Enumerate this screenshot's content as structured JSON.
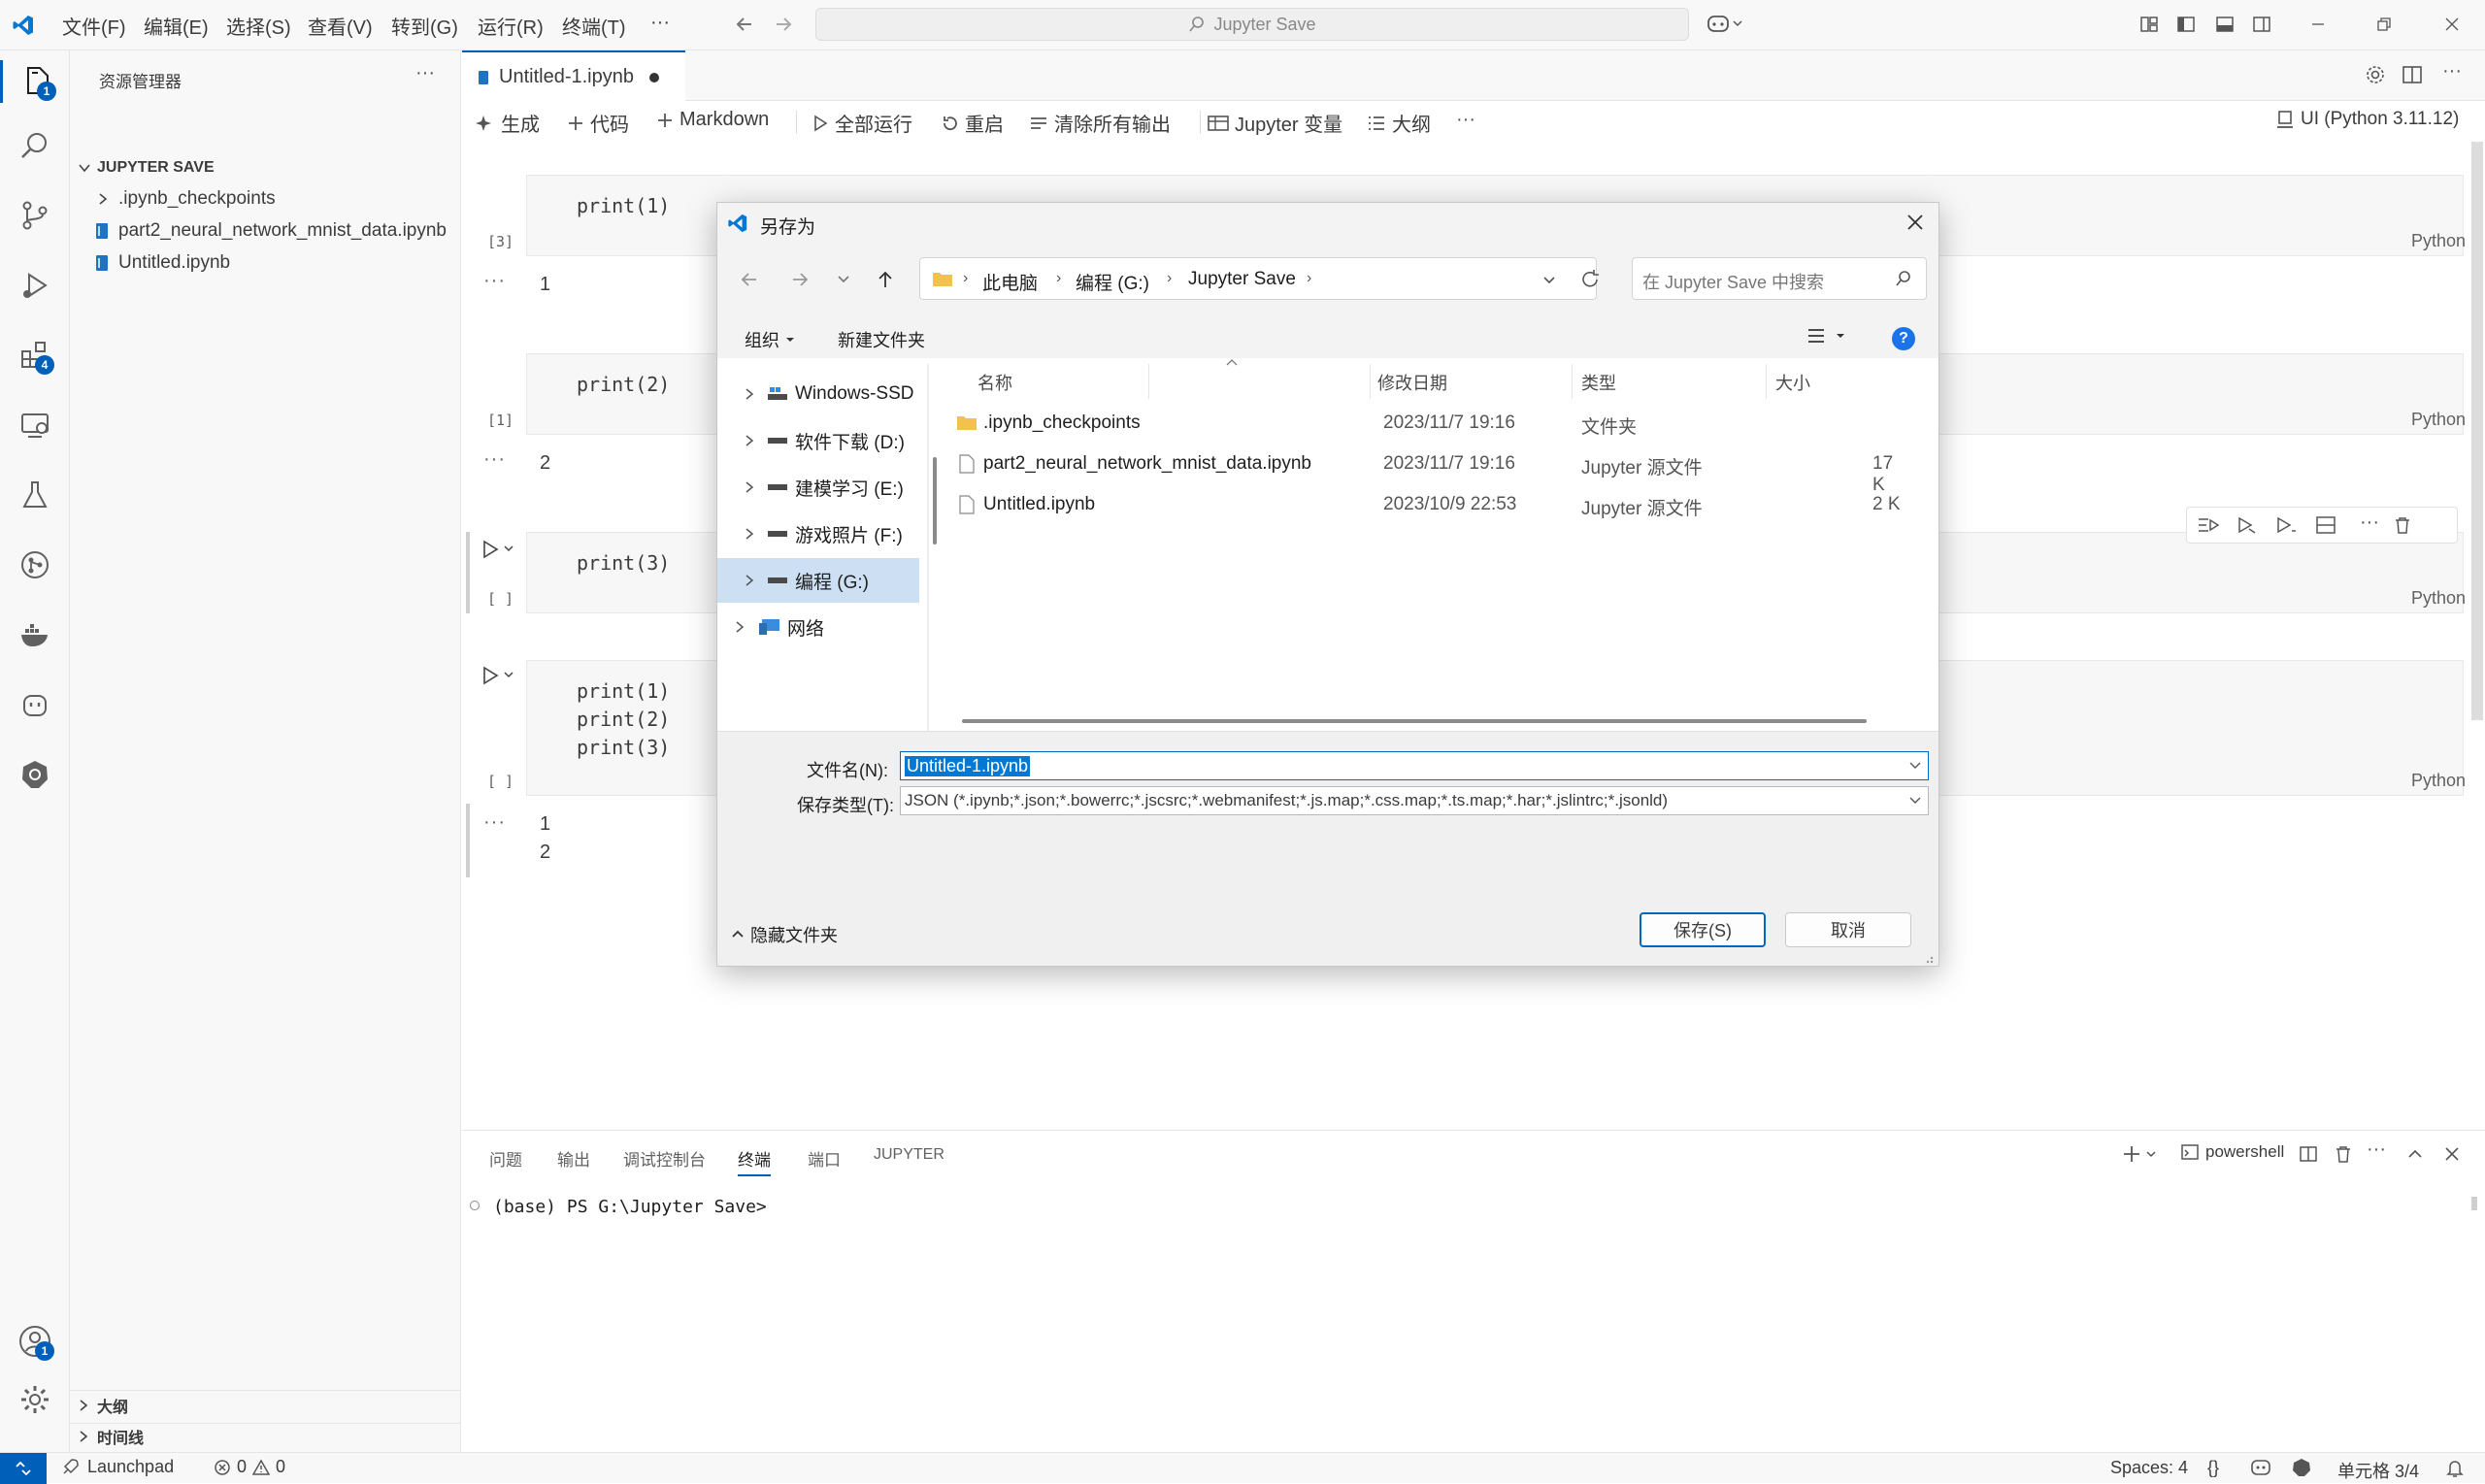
{
  "titlebar": {
    "menus": [
      "文件(F)",
      "编辑(E)",
      "选择(S)",
      "查看(V)",
      "转到(G)",
      "运行(R)",
      "终端(T)",
      "···"
    ],
    "search_text": "Jupyter Save"
  },
  "activity": {
    "explorer_badge": "1",
    "extensions_badge": "4",
    "accounts_badge": "1"
  },
  "sidebar": {
    "title": "资源管理器",
    "folder": "JUPYTER SAVE",
    "items": [
      ".ipynb_checkpoints",
      "part2_neural_network_mnist_data.ipynb",
      "Untitled.ipynb"
    ],
    "outline": "大纲",
    "timeline": "时间线"
  },
  "editor": {
    "tab_label": "Untitled-1.ipynb",
    "toolbar": {
      "generate": "生成",
      "code": "代码",
      "markdown": "Markdown",
      "run_all": "全部运行",
      "restart": "重启",
      "clear": "清除所有输出",
      "variables": "Jupyter 变量",
      "outline": "大纲",
      "more": "···",
      "kernel": "UI (Python 3.11.12)"
    },
    "cells": [
      {
        "count": "[3]",
        "code": [
          "print(1)"
        ],
        "lang": "Python",
        "output": [
          "1"
        ]
      },
      {
        "count": "[1]",
        "code": [
          "print(2)"
        ],
        "lang": "Python",
        "output": [
          "2"
        ]
      },
      {
        "count": "[ ]",
        "code": [
          "print(3)"
        ],
        "lang": "Python",
        "output": []
      },
      {
        "count": "[ ]",
        "code": [
          "print(1)",
          "print(2)",
          "print(3)"
        ],
        "lang": "Python",
        "output": [
          "1",
          "2"
        ]
      }
    ]
  },
  "panel": {
    "tabs": [
      "问题",
      "输出",
      "调试控制台",
      "终端",
      "端口",
      "JUPYTER"
    ],
    "active_tab": "终端",
    "shell": "powershell",
    "prompt": "(base) PS G:\\Jupyter Save>"
  },
  "statusbar": {
    "launchpad": "Launchpad",
    "errors": "0",
    "warnings": "0",
    "spaces": "Spaces: 4",
    "braces": "{}",
    "cell": "单元格 3/4"
  },
  "dialog": {
    "title": "另存为",
    "breadcrumb": [
      "此电脑",
      "编程 (G:)",
      "Jupyter Save"
    ],
    "search_placeholder": "在 Jupyter Save 中搜索",
    "organize": "组织",
    "new_folder": "新建文件夹",
    "nav": [
      "Windows-SSD",
      "软件下载 (D:)",
      "建模学习 (E:)",
      "游戏照片 (F:)",
      "编程 (G:)",
      "网络"
    ],
    "selected_nav": "编程 (G:)",
    "columns": {
      "name": "名称",
      "date": "修改日期",
      "type": "类型",
      "size": "大小"
    },
    "files": [
      {
        "name": ".ipynb_checkpoints",
        "date": "2023/11/7 19:16",
        "type": "文件夹",
        "size": ""
      },
      {
        "name": "part2_neural_network_mnist_data.ipynb",
        "date": "2023/11/7 19:16",
        "type": "Jupyter 源文件",
        "size": "17 K"
      },
      {
        "name": "Untitled.ipynb",
        "date": "2023/10/9 22:53",
        "type": "Jupyter 源文件",
        "size": "2 K"
      }
    ],
    "filename_label": "文件名(N):",
    "filename_value": "Untitled-1.ipynb",
    "filetype_label": "保存类型(T):",
    "filetype_value": "JSON (*.ipynb;*.json;*.bowerrc;*.jscsrc;*.webmanifest;*.js.map;*.css.map;*.ts.map;*.har;*.jslintrc;*.jsonld)",
    "hide_folders": "隐藏文件夹",
    "save": "保存(S)",
    "cancel": "取消"
  },
  "colors": {
    "accent": "#005fb8",
    "selection": "#0078d4",
    "folder": "#f2c14e"
  }
}
